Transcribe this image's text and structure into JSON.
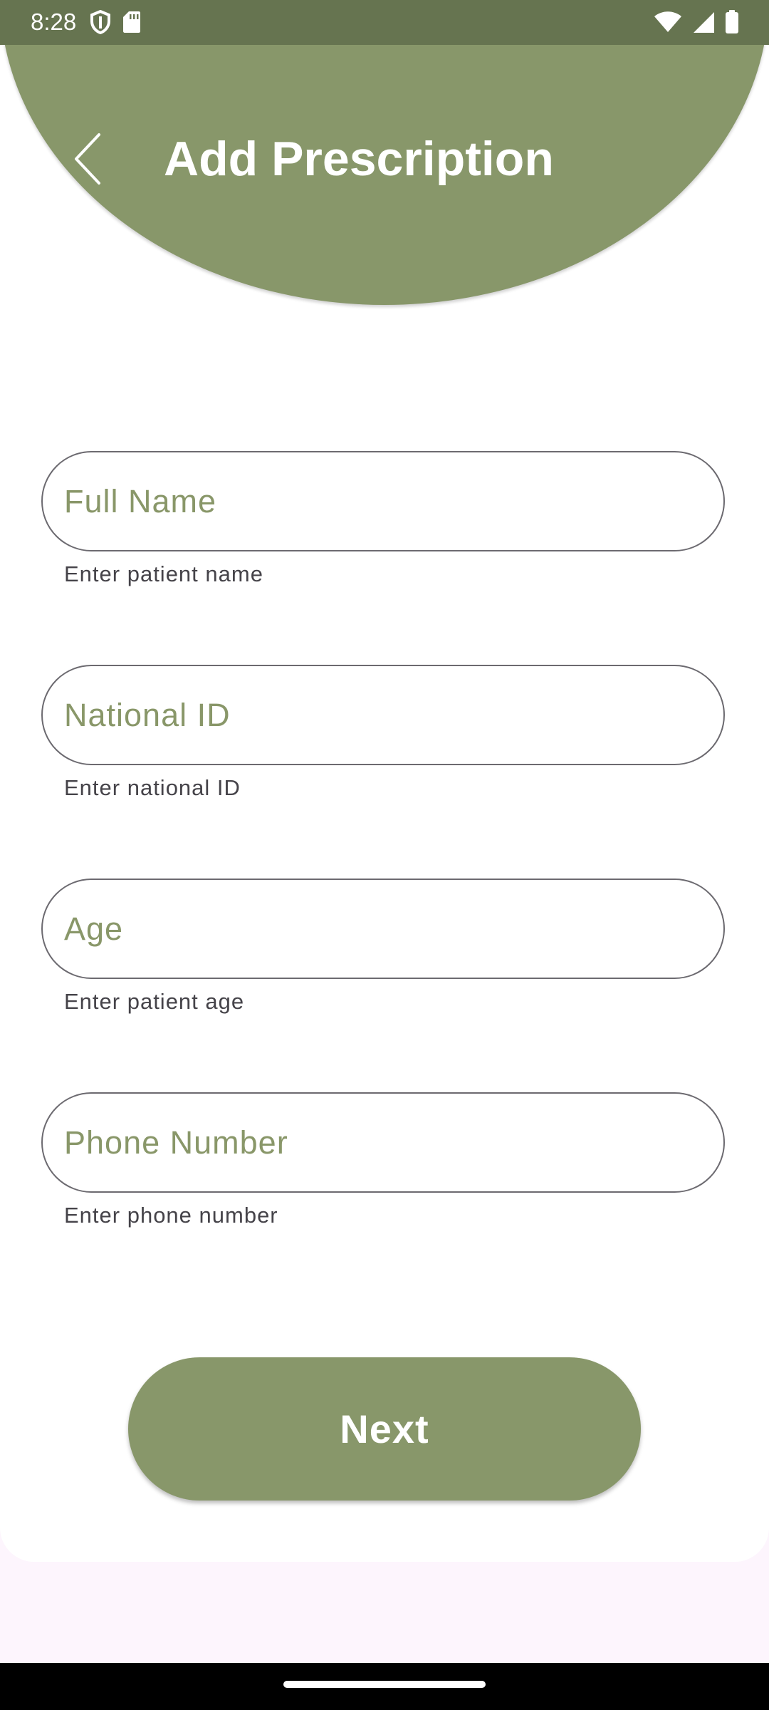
{
  "status_bar": {
    "time": "8:28",
    "left_icons": [
      "shield-icon",
      "sd-card-icon"
    ],
    "right_icons": [
      "wifi-icon",
      "cellular-signal-icon",
      "battery-icon"
    ]
  },
  "header": {
    "title": "Add Prescription",
    "back_icon": "chevron-left-icon"
  },
  "form": {
    "fields": [
      {
        "placeholder": "Full Name",
        "helper": "Enter patient name"
      },
      {
        "placeholder": "National ID",
        "helper": "Enter national ID"
      },
      {
        "placeholder": "Age",
        "helper": "Enter patient age"
      },
      {
        "placeholder": "Phone Number",
        "helper": "Enter phone number"
      }
    ],
    "next_label": "Next"
  },
  "colors": {
    "accent": "#88976A",
    "status_bar": "#667450",
    "placeholder": "#899769",
    "outline": "#6C6A70",
    "page_background": "#FDF5FD"
  }
}
